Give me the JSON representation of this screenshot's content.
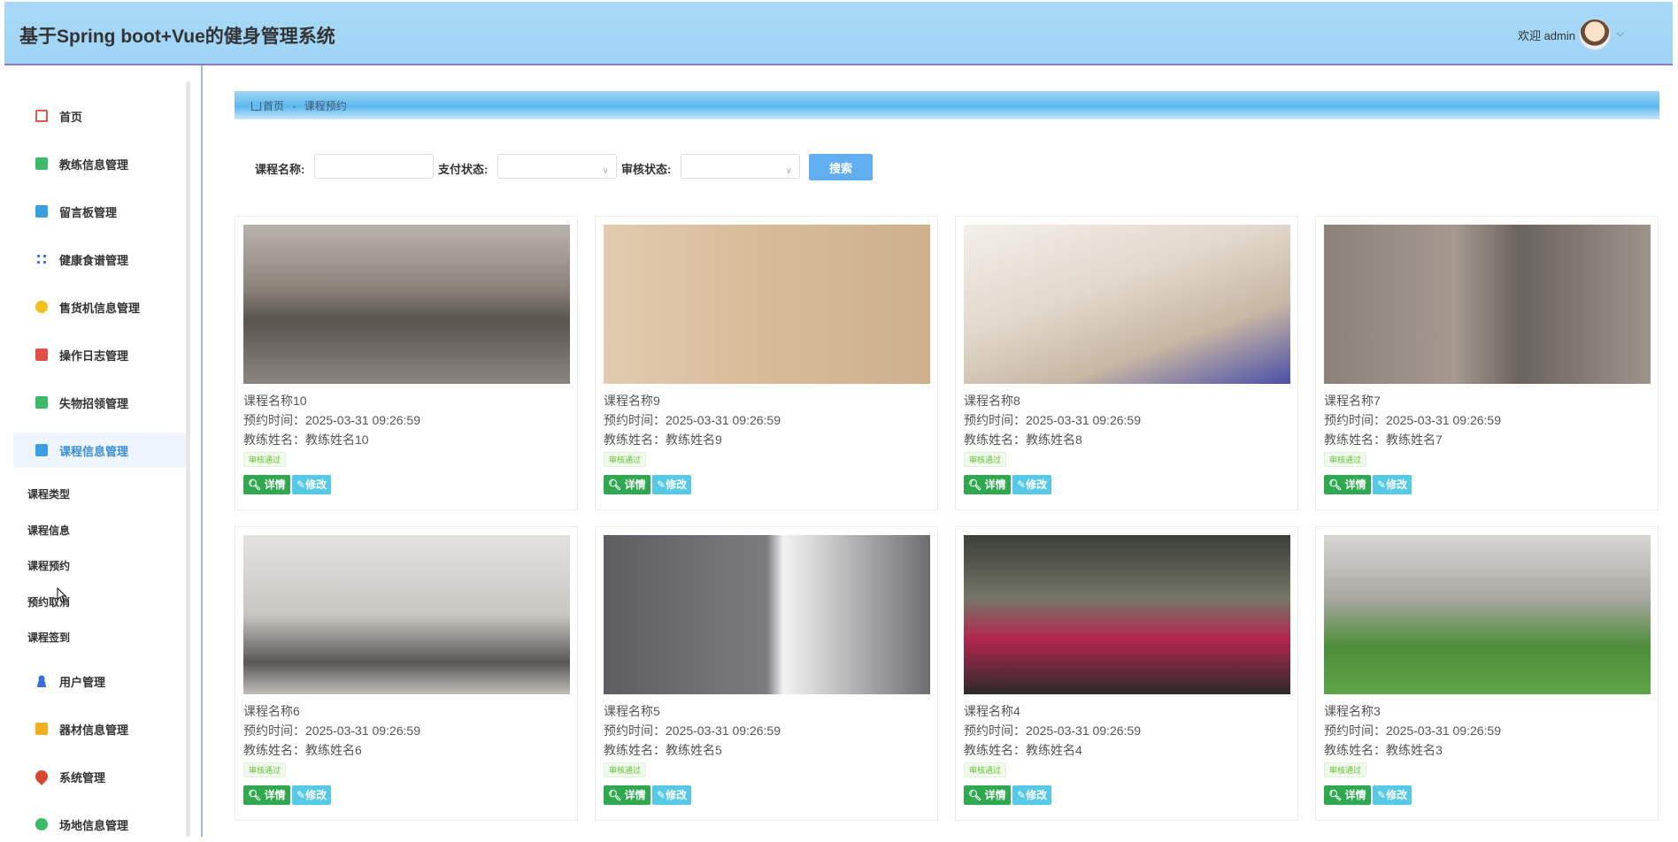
{
  "app_title": "基于Spring boot+Vue的健身管理系统",
  "user": {
    "welcome": "欢迎 admin",
    "caret": "⌵"
  },
  "sidebar": {
    "items": [
      {
        "label": "首页",
        "icon": "home-icon",
        "color": "#e05a4f"
      },
      {
        "label": "教练信息管理",
        "icon": "grid-icon",
        "color": "#3cba6a"
      },
      {
        "label": "留言板管理",
        "icon": "board-icon",
        "color": "#3b9ee0"
      },
      {
        "label": "健康食谱管理",
        "icon": "cluster-icon",
        "color": "#3a6fe0"
      },
      {
        "label": "售货机信息管理",
        "icon": "coin-icon",
        "color": "#f0c020"
      },
      {
        "label": "操作日志管理",
        "icon": "log-icon",
        "color": "#e0504a"
      },
      {
        "label": "失物招领管理",
        "icon": "grid-icon",
        "color": "#3cba6a"
      },
      {
        "label": "课程信息管理",
        "icon": "course-icon",
        "color": "#3b9ee0"
      }
    ],
    "subitems": [
      "课程类型",
      "课程信息",
      "课程预约",
      "预约取消",
      "课程签到"
    ],
    "items_after": [
      {
        "label": "用户管理",
        "icon": "user-icon",
        "color": "#3a6fe0"
      },
      {
        "label": "器材信息管理",
        "icon": "folder-icon",
        "color": "#f0b020"
      },
      {
        "label": "系统管理",
        "icon": "drop-icon",
        "color": "#d84a2f"
      },
      {
        "label": "场地信息管理",
        "icon": "circle-icon",
        "color": "#3cba6a"
      }
    ]
  },
  "breadcrumb": {
    "home": "首页",
    "sep": "-",
    "current": "课程预约"
  },
  "search": {
    "course_label": "课程名称:",
    "pay_label": "支付状态:",
    "audit_label": "审核状态:",
    "button": "搜索",
    "course_value": "",
    "pay_value": "",
    "audit_value": ""
  },
  "cards": [
    {
      "name": "课程名称10",
      "time": "预约时间：2025-03-31 09:26:59",
      "coach": "教练姓名：教练姓名10",
      "status": "审核通过",
      "photo": "treadmill-gym"
    },
    {
      "name": "课程名称9",
      "time": "预约时间：2025-03-31 09:26:59",
      "coach": "教练姓名：教练姓名9",
      "status": "审核通过",
      "photo": "yoga-curtain"
    },
    {
      "name": "课程名称8",
      "time": "预约时间：2025-03-31 09:26:59",
      "coach": "教练姓名：教练姓名8",
      "status": "审核通过",
      "photo": "stretch-white"
    },
    {
      "name": "课程名称7",
      "time": "预约时间：2025-03-31 09:26:59",
      "coach": "教练姓名：教练姓名7",
      "status": "审核通过",
      "photo": "stone-wall"
    },
    {
      "name": "课程名称6",
      "time": "预约时间：2025-03-31 09:26:59",
      "coach": "教练姓名：教练姓名6",
      "status": "审核通过",
      "photo": "bench-workout"
    },
    {
      "name": "课程名称5",
      "time": "预约时间：2025-03-31 09:26:59",
      "coach": "教练姓名：教练姓名5",
      "status": "审核通过",
      "photo": "badminton"
    },
    {
      "name": "课程名称4",
      "time": "预约时间：2025-03-31 09:26:59",
      "coach": "教练姓名：教练姓名4",
      "status": "审核通过",
      "photo": "squat-rack"
    },
    {
      "name": "课程名称3",
      "time": "预约时间：2025-03-31 09:26:59",
      "coach": "教练姓名：教练姓名3",
      "status": "审核通过",
      "photo": "stretch-class"
    }
  ],
  "card_buttons": {
    "detail": "详情",
    "edit": "修改"
  }
}
